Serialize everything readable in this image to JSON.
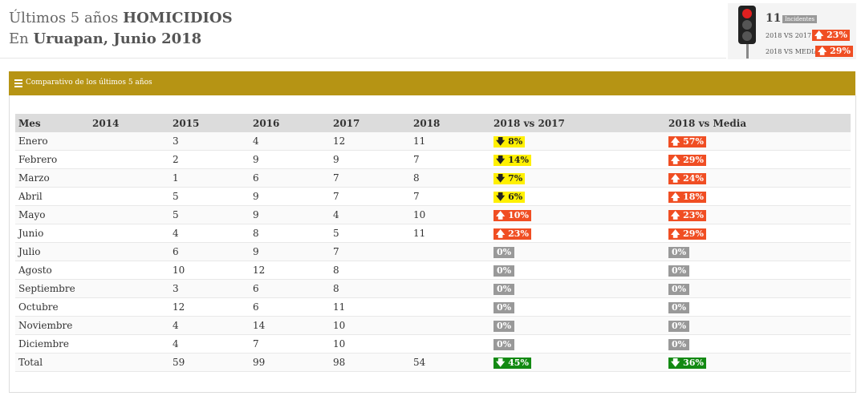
{
  "header": {
    "line1_prefix": "Últimos 5 años",
    "line1_bold": "HOMICIDIOS",
    "line2_prefix": "En",
    "line2_bold": "Uruapan, Junio 2018"
  },
  "widget": {
    "count": "11",
    "count_label": "Incidentes",
    "row1_label": "2018 VS 2017",
    "row1_value": "23%",
    "row2_label": "2018 VS MEDIA",
    "row2_value": "29%",
    "light_state": "red"
  },
  "panel": {
    "title": "Comparativo de los últimos 5 años"
  },
  "table": {
    "columns": [
      "Mes",
      "2014",
      "2015",
      "2016",
      "2017",
      "2018",
      "2018 vs 2017",
      "2018 vs Media"
    ],
    "rows": [
      {
        "mes": "Enero",
        "y2014": "",
        "y2015": "3",
        "y2016": "4",
        "y2017": "12",
        "y2018": "11",
        "vs2017": {
          "text": "8%",
          "style": "down-yellow"
        },
        "vsMedia": {
          "text": "57%",
          "style": "up-orange"
        }
      },
      {
        "mes": "Febrero",
        "y2014": "",
        "y2015": "2",
        "y2016": "9",
        "y2017": "9",
        "y2018": "7",
        "vs2017": {
          "text": "14%",
          "style": "down-yellow"
        },
        "vsMedia": {
          "text": "29%",
          "style": "up-orange"
        }
      },
      {
        "mes": "Marzo",
        "y2014": "",
        "y2015": "1",
        "y2016": "6",
        "y2017": "7",
        "y2018": "8",
        "vs2017": {
          "text": "7%",
          "style": "down-yellow"
        },
        "vsMedia": {
          "text": "24%",
          "style": "up-orange"
        }
      },
      {
        "mes": "Abril",
        "y2014": "",
        "y2015": "5",
        "y2016": "9",
        "y2017": "7",
        "y2018": "7",
        "vs2017": {
          "text": "6%",
          "style": "down-yellow"
        },
        "vsMedia": {
          "text": "18%",
          "style": "up-orange"
        }
      },
      {
        "mes": "Mayo",
        "y2014": "",
        "y2015": "5",
        "y2016": "9",
        "y2017": "4",
        "y2018": "10",
        "vs2017": {
          "text": "10%",
          "style": "up-orange"
        },
        "vsMedia": {
          "text": "23%",
          "style": "up-orange"
        }
      },
      {
        "mes": "Junio",
        "y2014": "",
        "y2015": "4",
        "y2016": "8",
        "y2017": "5",
        "y2018": "11",
        "vs2017": {
          "text": "23%",
          "style": "up-orange"
        },
        "vsMedia": {
          "text": "29%",
          "style": "up-orange"
        }
      },
      {
        "mes": "Julio",
        "y2014": "",
        "y2015": "6",
        "y2016": "9",
        "y2017": "7",
        "y2018": "",
        "vs2017": {
          "text": "0%",
          "style": "neutral"
        },
        "vsMedia": {
          "text": "0%",
          "style": "neutral"
        }
      },
      {
        "mes": "Agosto",
        "y2014": "",
        "y2015": "10",
        "y2016": "12",
        "y2017": "8",
        "y2018": "",
        "vs2017": {
          "text": "0%",
          "style": "neutral"
        },
        "vsMedia": {
          "text": "0%",
          "style": "neutral"
        }
      },
      {
        "mes": "Septiembre",
        "y2014": "",
        "y2015": "3",
        "y2016": "6",
        "y2017": "8",
        "y2018": "",
        "vs2017": {
          "text": "0%",
          "style": "neutral"
        },
        "vsMedia": {
          "text": "0%",
          "style": "neutral"
        }
      },
      {
        "mes": "Octubre",
        "y2014": "",
        "y2015": "12",
        "y2016": "6",
        "y2017": "11",
        "y2018": "",
        "vs2017": {
          "text": "0%",
          "style": "neutral"
        },
        "vsMedia": {
          "text": "0%",
          "style": "neutral"
        }
      },
      {
        "mes": "Noviembre",
        "y2014": "",
        "y2015": "4",
        "y2016": "14",
        "y2017": "10",
        "y2018": "",
        "vs2017": {
          "text": "0%",
          "style": "neutral"
        },
        "vsMedia": {
          "text": "0%",
          "style": "neutral"
        }
      },
      {
        "mes": "Diciembre",
        "y2014": "",
        "y2015": "4",
        "y2016": "7",
        "y2017": "10",
        "y2018": "",
        "vs2017": {
          "text": "0%",
          "style": "neutral"
        },
        "vsMedia": {
          "text": "0%",
          "style": "neutral"
        }
      }
    ],
    "total": {
      "mes": "Total",
      "y2014": "",
      "y2015": "59",
      "y2016": "99",
      "y2017": "98",
      "y2018": "54",
      "vs2017": {
        "text": "45%",
        "style": "down-green"
      },
      "vsMedia": {
        "text": "36%",
        "style": "down-green"
      }
    }
  },
  "colors": {
    "panel_header": "#b69414",
    "up_badge": "#f04e23",
    "down_badge_yellow": "#fff000",
    "down_badge_green": "#138a13",
    "neutral_badge": "#999999"
  }
}
